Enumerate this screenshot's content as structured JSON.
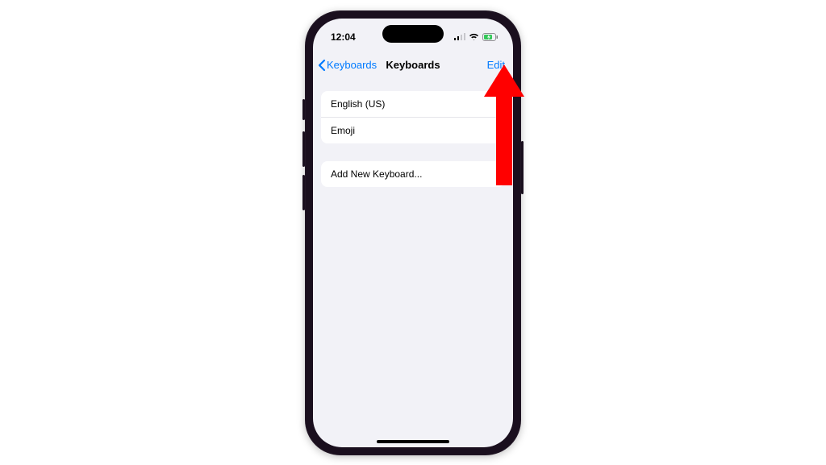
{
  "status": {
    "time": "12:04"
  },
  "nav": {
    "back_label": "Keyboards",
    "title": "Keyboards",
    "edit_label": "Edit"
  },
  "keyboards": [
    {
      "label": "English (US)"
    },
    {
      "label": "Emoji"
    }
  ],
  "add": {
    "label": "Add New Keyboard..."
  },
  "colors": {
    "tint": "#007aff",
    "bg": "#f2f2f7",
    "annotation": "#ff0000"
  }
}
